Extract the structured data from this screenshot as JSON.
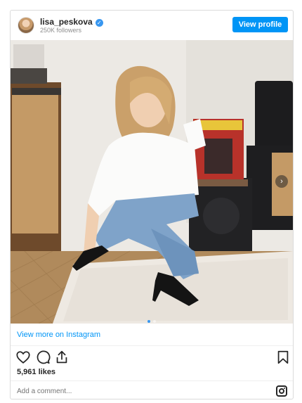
{
  "header": {
    "username": "lisa_peskova",
    "followers": "250K followers",
    "view_profile_label": "View profile",
    "verified_icon": "verified-badge-icon"
  },
  "post": {
    "image_description_icon": "photo",
    "carousel": {
      "total": 2,
      "active": 1
    }
  },
  "view_more": "View more on Instagram",
  "likes": "5,961 likes",
  "comment": {
    "placeholder": "Add a comment..."
  },
  "icons": [
    "heart-icon",
    "comment-icon",
    "share-icon",
    "bookmark-icon",
    "instagram-icon",
    "chevron-right-icon"
  ],
  "colors": {
    "accent": "#0095f6",
    "text": "#262626",
    "muted": "#8e8e8e"
  }
}
